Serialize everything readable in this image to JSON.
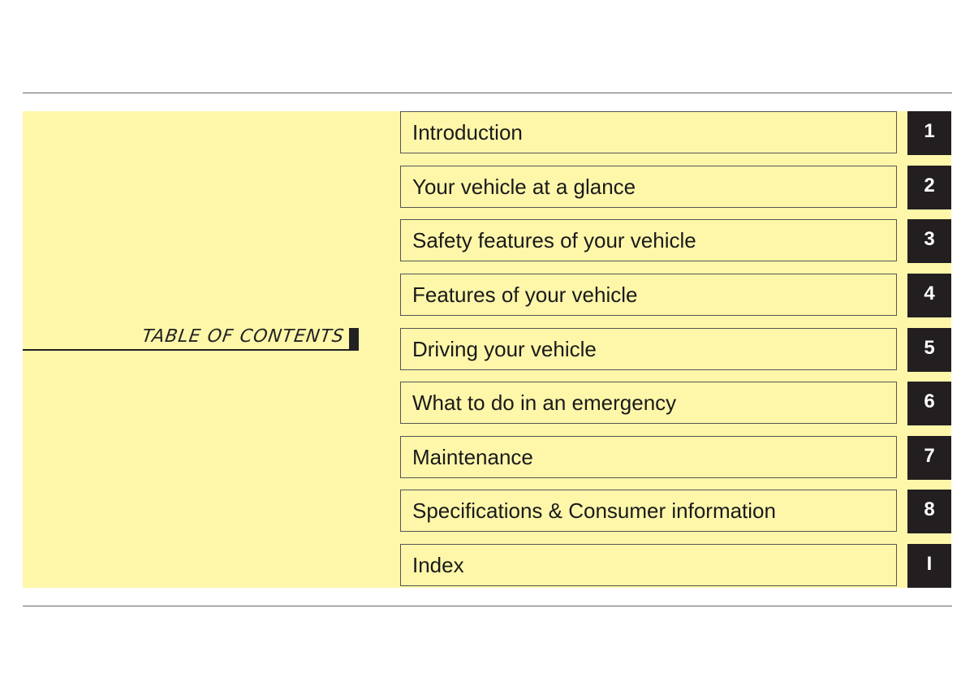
{
  "title": "TABLE OF CONTENTS",
  "entries": [
    {
      "label": "Introduction",
      "tab": "1"
    },
    {
      "label": "Your vehicle at a glance",
      "tab": "2"
    },
    {
      "label": "Safety features of your vehicle",
      "tab": "3"
    },
    {
      "label": "Features of your vehicle",
      "tab": "4"
    },
    {
      "label": "Driving your vehicle",
      "tab": "5"
    },
    {
      "label": "What to do in an emergency",
      "tab": "6"
    },
    {
      "label": "Maintenance",
      "tab": "7"
    },
    {
      "label": "Specifications & Consumer information",
      "tab": "8"
    },
    {
      "label": "Index",
      "tab": "I"
    }
  ],
  "colors": {
    "panel": "#fef7aa",
    "tab": "#231f20"
  }
}
